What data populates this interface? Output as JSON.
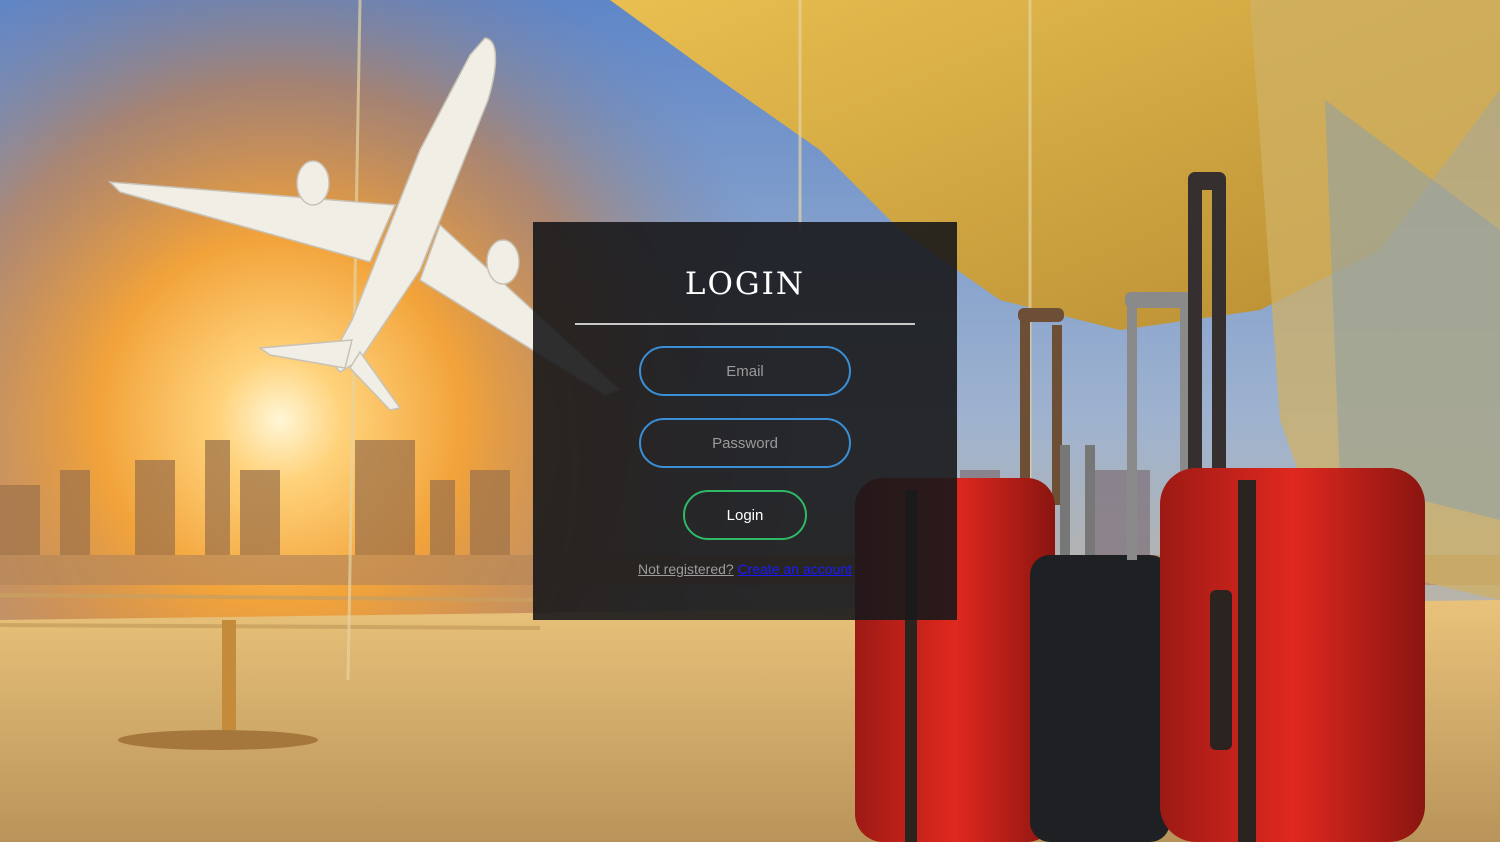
{
  "login": {
    "title": "LOGIN",
    "email_placeholder": "Email",
    "password_placeholder": "Password",
    "submit_label": "Login",
    "register_prompt": "Not registered?",
    "register_link": "Create an account"
  },
  "colors": {
    "panel_background": "#18181b",
    "input_border": "#3a8fd6",
    "button_border": "#2fb866",
    "link": "#1a1aff"
  },
  "background": {
    "scene": "airport terminal with airplane taking off at sunset and red luggage"
  }
}
